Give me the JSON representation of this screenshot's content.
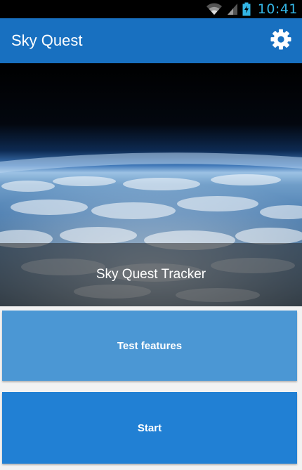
{
  "status_bar": {
    "time": "10:41",
    "icons": [
      "wifi-icon",
      "signal-icon",
      "battery-charging-icon"
    ]
  },
  "action_bar": {
    "title": "Sky Quest",
    "settings_icon": "gear-icon"
  },
  "hero": {
    "caption": "Sky Quest Tracker"
  },
  "buttons": {
    "test_features": "Test features",
    "start": "Start"
  },
  "colors": {
    "action_bar": "#1870c0",
    "clock": "#33b5e5",
    "test_button": "#4b97d4",
    "start_button": "#2180d4"
  }
}
